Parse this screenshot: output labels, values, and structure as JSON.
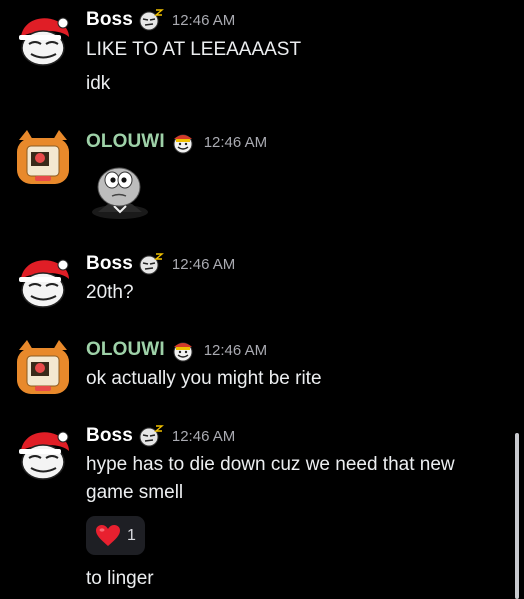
{
  "colors": {
    "boss_name": "#ffffff",
    "olouwi_name": "#9ed1a8",
    "timestamp": "#a9aab1",
    "message_text": "#eceef0",
    "reaction_bg": "#1e1f24",
    "background": "#000000"
  },
  "messages": [
    {
      "author": "Boss",
      "time": "12:46 AM",
      "avatar_icon": "troll-face-santa-hat-icon",
      "badge_icon": "sleepy-emoji-badge-icon",
      "lines": [
        "LIKE TO AT LEEAAAAST",
        "idk"
      ]
    },
    {
      "author": "OLOUWI",
      "time": "12:46 AM",
      "avatar_icon": "cat-pizza-avatar-icon",
      "badge_icon": "party-face-badge-icon",
      "sticker_icon": "googly-eyes-sticker-icon"
    },
    {
      "author": "Boss",
      "time": "12:46 AM",
      "lines": [
        "20th?"
      ]
    },
    {
      "author": "OLOUWI",
      "time": "12:46 AM",
      "lines": [
        "ok actually you might be rite"
      ]
    },
    {
      "author": "Boss",
      "time": "12:46 AM",
      "lines": [
        "hype has to die down cuz we need that new",
        "game smell"
      ],
      "reaction": {
        "emoji": "red-heart-icon",
        "count": "1"
      },
      "after_reaction": "to linger"
    }
  ]
}
